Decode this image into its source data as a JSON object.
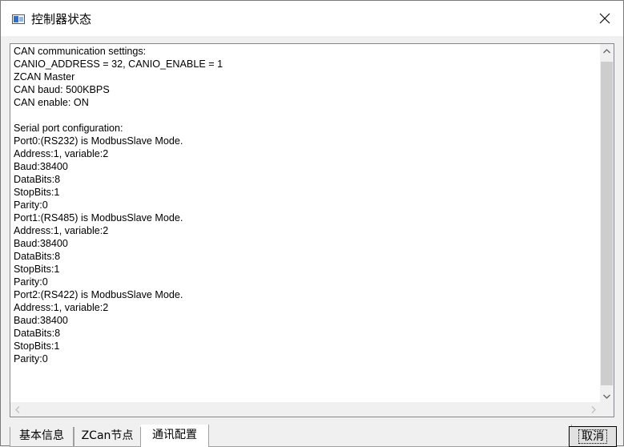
{
  "window": {
    "title": "控制器状态",
    "close_label": "×"
  },
  "content": {
    "lines": [
      "CAN communication settings:",
      "CANIO_ADDRESS = 32, CANIO_ENABLE = 1",
      "ZCAN Master",
      "CAN baud: 500KBPS",
      "CAN enable: ON",
      "",
      "Serial port configuration:",
      "Port0:(RS232) is ModbusSlave Mode.",
      "Address:1, variable:2",
      "Baud:38400",
      "DataBits:8",
      "StopBits:1",
      "Parity:0",
      "Port1:(RS485) is ModbusSlave Mode.",
      "Address:1, variable:2",
      "Baud:38400",
      "DataBits:8",
      "StopBits:1",
      "Parity:0",
      "Port2:(RS422) is ModbusSlave Mode.",
      "Address:1, variable:2",
      "Baud:38400",
      "DataBits:8",
      "StopBits:1",
      "Parity:0"
    ]
  },
  "tabs": [
    {
      "label": "基本信息",
      "active": false
    },
    {
      "label": "ZCan节点",
      "active": false
    },
    {
      "label": "通讯配置",
      "active": true
    }
  ],
  "buttons": {
    "cancel_label": "取消"
  },
  "icons": {
    "app": "window-app-icon",
    "close": "close-icon",
    "scroll_up": "chevron-up-icon",
    "scroll_down": "chevron-down-icon",
    "scroll_left": "chevron-left-icon",
    "scroll_right": "chevron-right-icon"
  }
}
